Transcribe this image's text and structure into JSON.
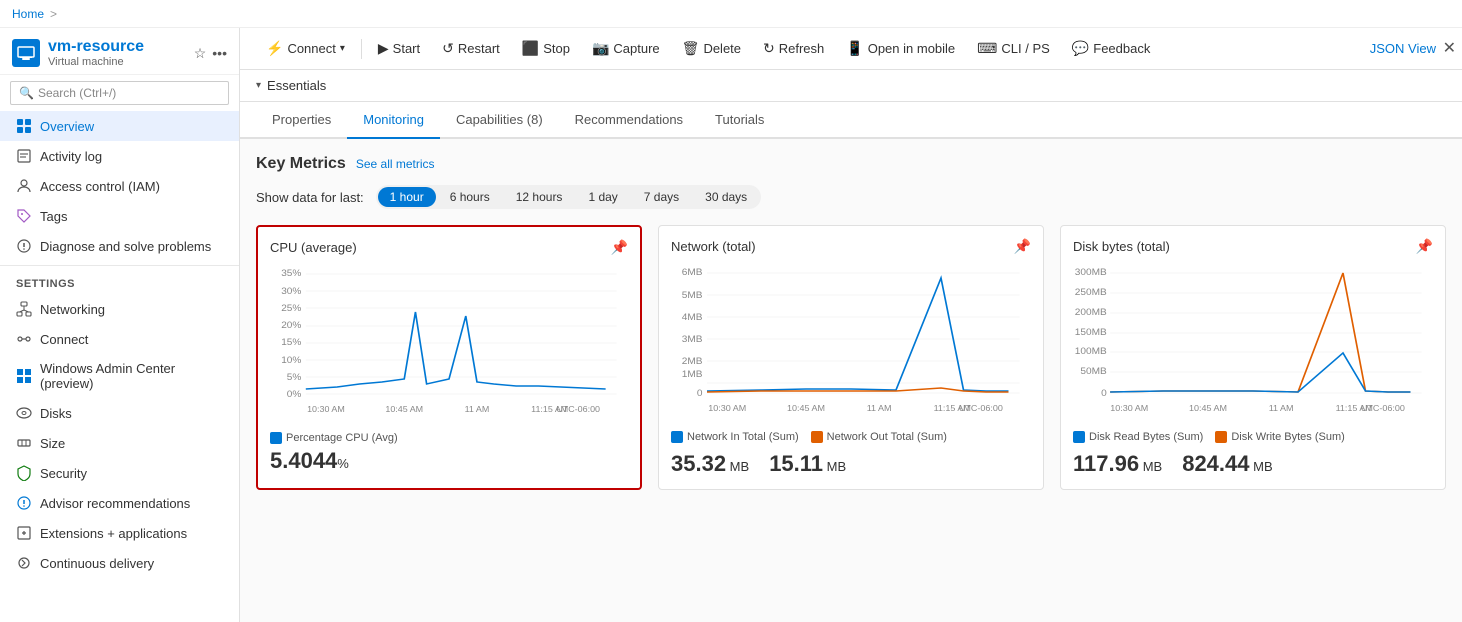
{
  "breadcrumb": {
    "home": "Home",
    "separator": ">"
  },
  "vm": {
    "name": "vm-resource",
    "type": "Virtual machine"
  },
  "toolbar": {
    "connect_label": "Connect",
    "start_label": "Start",
    "restart_label": "Restart",
    "stop_label": "Stop",
    "capture_label": "Capture",
    "delete_label": "Delete",
    "refresh_label": "Refresh",
    "open_mobile_label": "Open in mobile",
    "cli_ps_label": "CLI / PS",
    "feedback_label": "Feedback",
    "json_view_label": "JSON View"
  },
  "essentials": {
    "label": "Essentials"
  },
  "tabs": [
    {
      "id": "properties",
      "label": "Properties"
    },
    {
      "id": "monitoring",
      "label": "Monitoring"
    },
    {
      "id": "capabilities",
      "label": "Capabilities (8)"
    },
    {
      "id": "recommendations",
      "label": "Recommendations"
    },
    {
      "id": "tutorials",
      "label": "Tutorials"
    }
  ],
  "monitoring": {
    "title": "Key Metrics",
    "see_all": "See all metrics",
    "show_data_label": "Show data for last:",
    "time_filters": [
      "1 hour",
      "6 hours",
      "12 hours",
      "1 day",
      "7 days",
      "30 days"
    ],
    "active_filter": "1 hour",
    "charts": [
      {
        "id": "cpu",
        "title": "CPU (average)",
        "selected": true,
        "legend": [
          {
            "label": "Percentage CPU (Avg)",
            "color": "#0078d4"
          }
        ],
        "values": [
          {
            "label": "5.4044",
            "unit": "%"
          }
        ],
        "yLabels": [
          "35%",
          "30%",
          "25%",
          "20%",
          "15%",
          "10%",
          "5%",
          "0%"
        ],
        "xLabels": [
          "10:30 AM",
          "10:45 AM",
          "11 AM",
          "11:15 AM",
          "UTC-06:00"
        ],
        "data_label": "5.4044",
        "data_unit": "%"
      },
      {
        "id": "network",
        "title": "Network (total)",
        "selected": false,
        "legend": [
          {
            "label": "Network In Total (Sum)",
            "color": "#0078d4"
          },
          {
            "label": "Network Out Total (Sum)",
            "color": "#e05f00"
          }
        ],
        "yLabels": [
          "6MB",
          "5MB",
          "4MB",
          "3MB",
          "2MB",
          "1MB",
          "0"
        ],
        "xLabels": [
          "10:30 AM",
          "10:45 AM",
          "11 AM",
          "11:15 AM",
          "UTC-06:00"
        ],
        "values": [
          {
            "label": "35.32",
            "unit": "MB"
          },
          {
            "label": "15.11",
            "unit": "MB"
          }
        ]
      },
      {
        "id": "disk",
        "title": "Disk bytes (total)",
        "selected": false,
        "legend": [
          {
            "label": "Disk Read Bytes (Sum)",
            "color": "#0078d4"
          },
          {
            "label": "Disk Write Bytes (Sum)",
            "color": "#e05f00"
          }
        ],
        "yLabels": [
          "300MB",
          "250MB",
          "200MB",
          "150MB",
          "100MB",
          "50MB",
          "0"
        ],
        "xLabels": [
          "10:30 AM",
          "10:45 AM",
          "11 AM",
          "11:15 AM",
          "UTC-06:00"
        ],
        "values": [
          {
            "label": "117.96",
            "unit": "MB"
          },
          {
            "label": "824.44",
            "unit": "MB"
          }
        ]
      }
    ]
  },
  "sidebar": {
    "search_placeholder": "Search (Ctrl+/)",
    "items": [
      {
        "id": "overview",
        "label": "Overview",
        "active": true,
        "icon": "grid"
      },
      {
        "id": "activity-log",
        "label": "Activity log",
        "active": false,
        "icon": "list"
      },
      {
        "id": "access-control",
        "label": "Access control (IAM)",
        "active": false,
        "icon": "person"
      },
      {
        "id": "tags",
        "label": "Tags",
        "active": false,
        "icon": "tag"
      },
      {
        "id": "diagnose",
        "label": "Diagnose and solve problems",
        "active": false,
        "icon": "tool"
      }
    ],
    "settings_title": "Settings",
    "settings_items": [
      {
        "id": "networking",
        "label": "Networking",
        "icon": "network"
      },
      {
        "id": "connect",
        "label": "Connect",
        "icon": "link"
      },
      {
        "id": "windows-admin",
        "label": "Windows Admin Center (preview)",
        "icon": "windows"
      },
      {
        "id": "disks",
        "label": "Disks",
        "icon": "disk"
      },
      {
        "id": "size",
        "label": "Size",
        "icon": "size"
      },
      {
        "id": "security",
        "label": "Security",
        "icon": "shield"
      },
      {
        "id": "advisor",
        "label": "Advisor recommendations",
        "icon": "advisor"
      },
      {
        "id": "extensions",
        "label": "Extensions + applications",
        "icon": "extension"
      },
      {
        "id": "continuous-delivery",
        "label": "Continuous delivery",
        "icon": "delivery"
      }
    ],
    "collapse_icon": "«"
  }
}
